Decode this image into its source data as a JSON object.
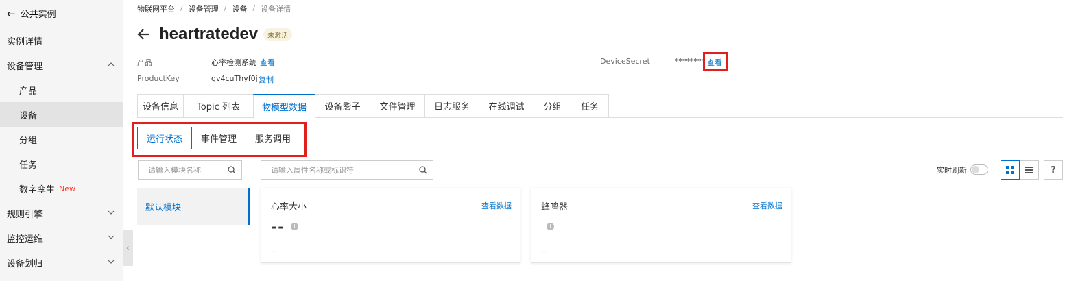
{
  "sidebar": {
    "back_label": "公共实例",
    "items": [
      {
        "label": "实例详情"
      },
      {
        "label": "设备管理"
      },
      {
        "label": "产品"
      },
      {
        "label": "设备"
      },
      {
        "label": "分组"
      },
      {
        "label": "任务"
      },
      {
        "label": "数字孪生",
        "badge": "New"
      },
      {
        "label": "规则引擎"
      },
      {
        "label": "监控运维"
      },
      {
        "label": "设备划归"
      }
    ]
  },
  "breadcrumb": [
    "物联网平台",
    "设备管理",
    "设备",
    "设备详情"
  ],
  "breadcrumb_sep": "/",
  "header": {
    "title": "heartratedev",
    "status": "未激活"
  },
  "meta": {
    "product_label": "产品",
    "product_value": "心率检测系统",
    "product_link": "查看",
    "productkey_label": "ProductKey",
    "productkey_value": "gv4cuThyf0j",
    "productkey_link": "复制",
    "secret_label": "DeviceSecret",
    "secret_value": "********",
    "secret_link": "查看"
  },
  "tabs": [
    "设备信息",
    "Topic 列表",
    "物模型数据",
    "设备影子",
    "文件管理",
    "日志服务",
    "在线调试",
    "分组",
    "任务"
  ],
  "active_tab": "物模型数据",
  "subtabs": [
    "运行状态",
    "事件管理",
    "服务调用"
  ],
  "module_search_placeholder": "请输入模块名称",
  "property_search_placeholder": "请输入属性名称或标识符",
  "module": "默认模块",
  "realtime_label": "实时刷新",
  "help": "?",
  "cards": [
    {
      "title": "心率大小",
      "link": "查看数据",
      "value": "--",
      "foot": "--"
    },
    {
      "title": "蜂鸣器",
      "link": "查看数据",
      "value": "",
      "foot": "--"
    }
  ],
  "colors": {
    "accent": "#0070cc",
    "highlight": "#e01f1f"
  }
}
